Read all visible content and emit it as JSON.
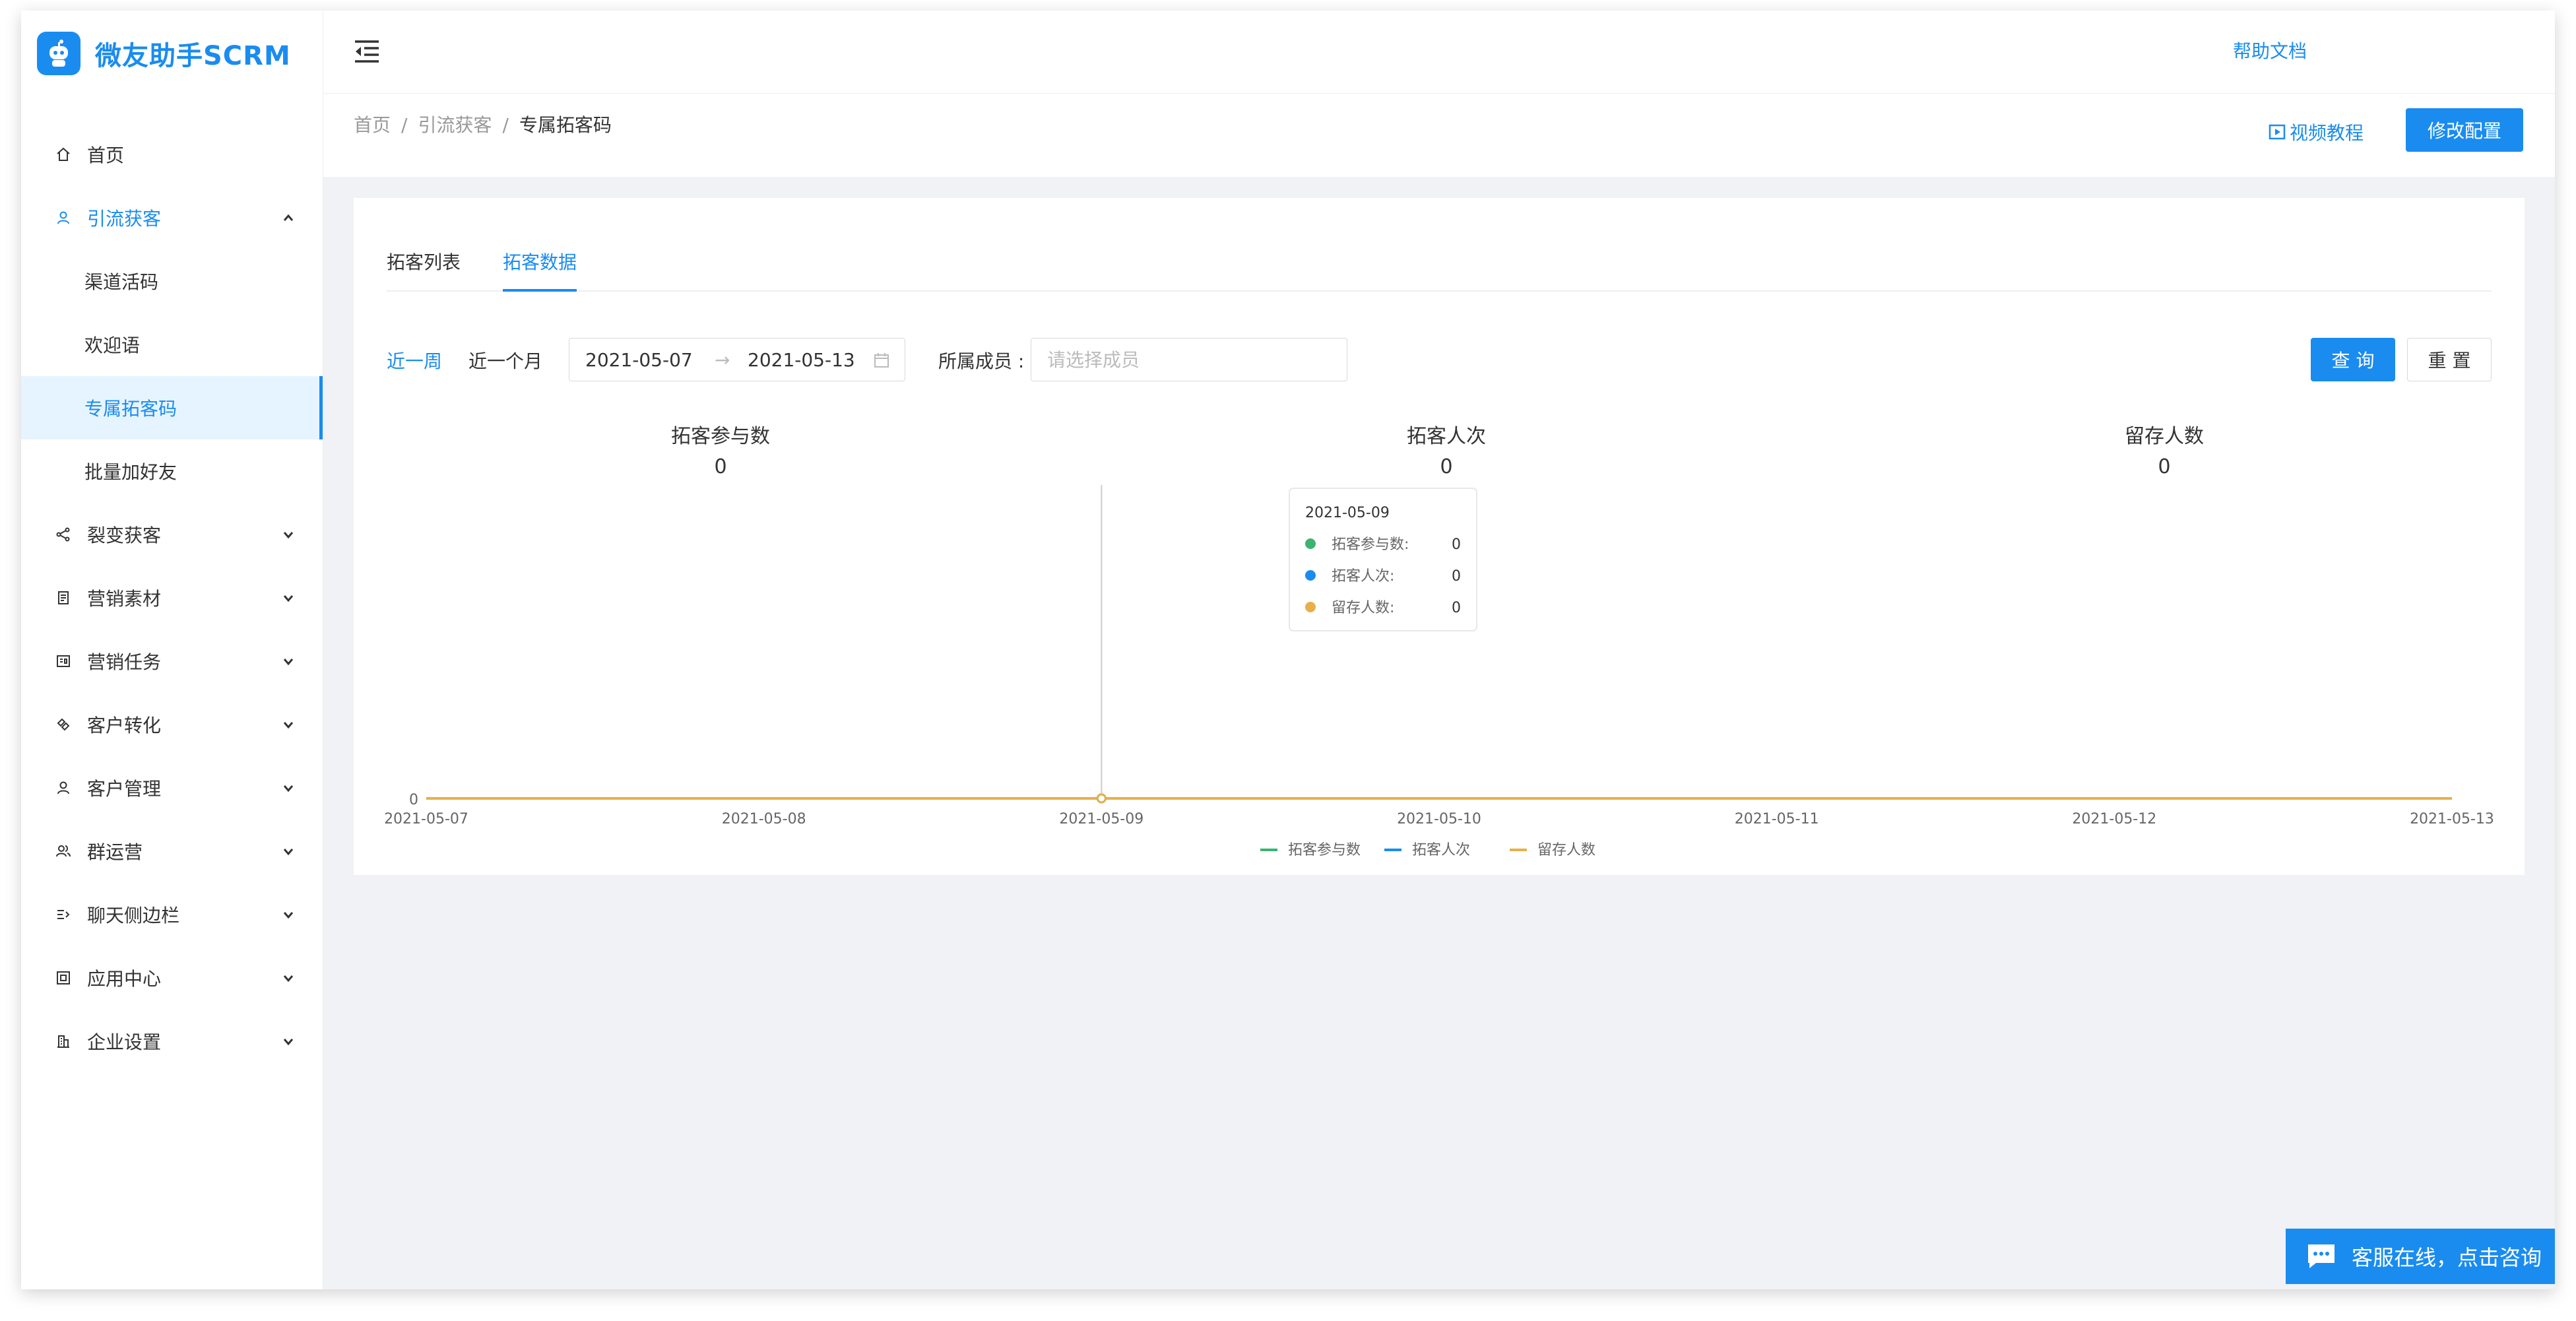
{
  "app": {
    "title": "微友助手SCRM"
  },
  "colors": {
    "accent": "#1a8cf0",
    "series_green": "#3cb371",
    "series_blue": "#1a8cf0",
    "series_orange": "#e6b04a"
  },
  "sidebar": {
    "items": [
      {
        "label": "首页",
        "icon": "home-icon"
      },
      {
        "label": "引流获客",
        "icon": "user-icon",
        "expanded": true
      },
      {
        "label": "渠道活码"
      },
      {
        "label": "欢迎语"
      },
      {
        "label": "专属拓客码",
        "active": true
      },
      {
        "label": "批量加好友"
      },
      {
        "label": "裂变获客",
        "icon": "share-icon"
      },
      {
        "label": "营销素材",
        "icon": "document-icon"
      },
      {
        "label": "营销任务",
        "icon": "task-icon"
      },
      {
        "label": "客户转化",
        "icon": "convert-icon"
      },
      {
        "label": "客户管理",
        "icon": "person-icon"
      },
      {
        "label": "群运营",
        "icon": "group-icon"
      },
      {
        "label": "聊天侧边栏",
        "icon": "sidebar-icon"
      },
      {
        "label": "应用中心",
        "icon": "app-icon"
      },
      {
        "label": "企业设置",
        "icon": "building-icon"
      }
    ]
  },
  "header": {
    "help": "帮助文档"
  },
  "breadcrumb": {
    "home": "首页",
    "parent": "引流获客",
    "current": "专属拓客码",
    "sep": "/"
  },
  "toolbar": {
    "video": "视频教程",
    "config": "修改配置"
  },
  "tabs": [
    {
      "label": "拓客列表"
    },
    {
      "label": "拓客数据",
      "active": true
    }
  ],
  "filter": {
    "week": "近一周",
    "month": "近一个月",
    "start_date": "2021-05-07",
    "end_date": "2021-05-13",
    "arrow": "→",
    "member_label": "所属成员 :",
    "member_placeholder": "请选择成员",
    "query": "查 询",
    "reset": "重 置"
  },
  "stats": [
    {
      "label": "拓客参与数",
      "value": "0"
    },
    {
      "label": "拓客人次",
      "value": "0"
    },
    {
      "label": "留存人数",
      "value": "0"
    }
  ],
  "chart_data": {
    "type": "line",
    "x": [
      "2021-05-07",
      "2021-05-08",
      "2021-05-09",
      "2021-05-10",
      "2021-05-11",
      "2021-05-12",
      "2021-05-13"
    ],
    "series": [
      {
        "name": "拓客参与数",
        "values": [
          0,
          0,
          0,
          0,
          0,
          0,
          0
        ],
        "color": "#3cb371"
      },
      {
        "name": "拓客人次",
        "values": [
          0,
          0,
          0,
          0,
          0,
          0,
          0
        ],
        "color": "#1a8cf0"
      },
      {
        "name": "留存人数",
        "values": [
          0,
          0,
          0,
          0,
          0,
          0,
          0
        ],
        "color": "#e6b04a"
      }
    ],
    "y_ticks": [
      "0"
    ],
    "ylim": [
      0,
      1
    ],
    "legend": "bottom",
    "tooltip": {
      "title": "2021-05-09",
      "x_index": 2,
      "rows": [
        {
          "label": "拓客参与数:",
          "value": "0"
        },
        {
          "label": "拓客人次:",
          "value": "0"
        },
        {
          "label": "留存人数:",
          "value": "0"
        }
      ]
    }
  },
  "customer_service": {
    "label": "客服在线，点击咨询"
  }
}
